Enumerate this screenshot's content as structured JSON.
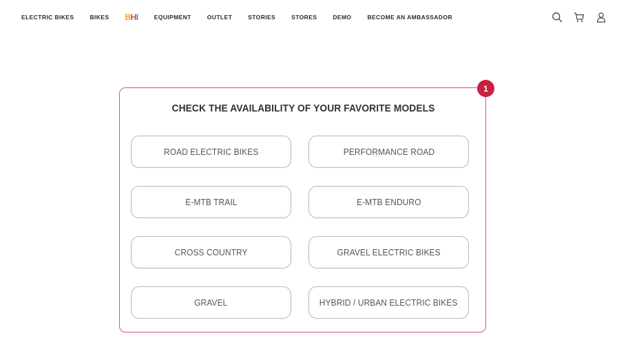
{
  "nav": {
    "items": [
      "ELECTRIC BIKES",
      "BIKES"
    ],
    "logo": {
      "b": "B",
      "h": "H",
      "i": "I"
    },
    "items_after_logo": [
      "EQUIPMENT",
      "OUTLET",
      "STORIES",
      "STORES",
      "DEMO",
      "BECOME AN AMBASSADOR"
    ],
    "icons": [
      "search-icon",
      "cart-icon",
      "user-icon"
    ]
  },
  "badge": "1",
  "card": {
    "title": "CHECK THE AVAILABILITY OF YOUR FAVORITE MODELS",
    "models": [
      "ROAD ELECTRIC BIKES",
      "PERFORMANCE ROAD",
      "E-MTB TRAIL",
      "E-MTB ENDURO",
      "CROSS COUNTRY",
      "GRAVEL ELECTRIC BIKES",
      "GRAVEL",
      "HYBRID / URBAN ELECTRIC BIKES"
    ]
  },
  "colors": {
    "card_border": "#d9536b",
    "badge_bg": "#c8203f",
    "logo_b": "#f4a11b",
    "logo_h": "#e2403b",
    "logo_i": "#1e9bd7"
  }
}
